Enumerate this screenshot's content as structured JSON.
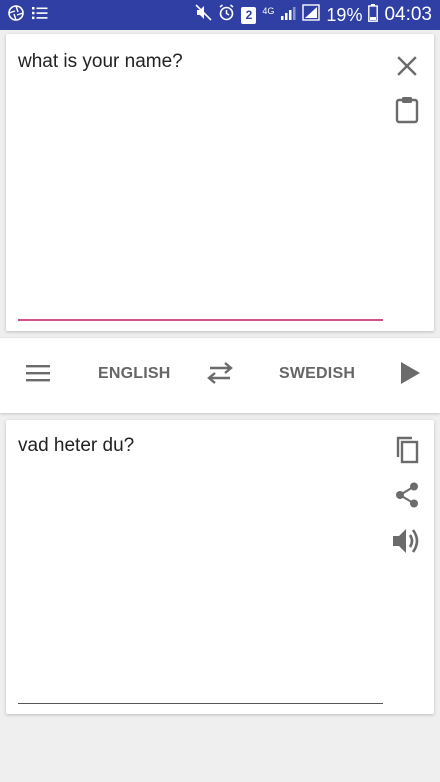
{
  "status_bar": {
    "battery_percent": "19%",
    "time": "04:03",
    "network": "4G",
    "sim_badge": "2",
    "background_color": "#2f3fa3",
    "left_icons": [
      "aperture-icon",
      "list-icon"
    ],
    "right_icons": [
      "mute-icon",
      "alarm-icon",
      "sim-icon",
      "network-icon",
      "signal-icon",
      "signal-icon",
      "battery-icon"
    ]
  },
  "source": {
    "text": "what is your name?",
    "underline_color": "#d0508a",
    "icons": [
      "close-icon",
      "clipboard-icon"
    ]
  },
  "language_bar": {
    "source_language": "ENGLISH",
    "target_language": "SWEDISH",
    "icons": [
      "menu-icon",
      "swap-icon",
      "play-icon"
    ]
  },
  "result": {
    "text": "vad heter du?",
    "icons": [
      "copy-icon",
      "share-icon",
      "volume-icon"
    ]
  }
}
